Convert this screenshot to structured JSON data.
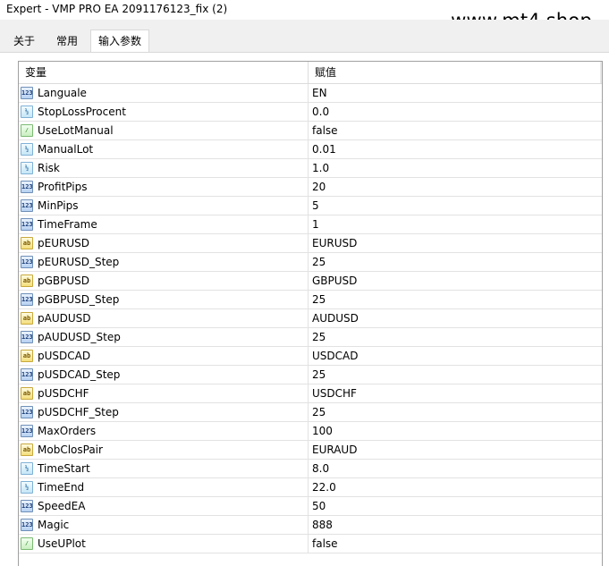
{
  "window": {
    "title": "Expert - VMP PRO EA 2091176123_fix (2)",
    "watermark": "www.mt4.shop"
  },
  "tabs": [
    {
      "label": "关于",
      "active": false
    },
    {
      "label": "常用",
      "active": false
    },
    {
      "label": "输入参数",
      "active": true
    }
  ],
  "grid": {
    "col_variable": "变量",
    "col_value": "赋值",
    "rows": [
      {
        "icon": "int-icon",
        "icon_text": "123",
        "name": "Languale",
        "value": "EN"
      },
      {
        "icon": "double-icon",
        "icon_text": "½",
        "name": "StopLossProcent",
        "value": "0.0"
      },
      {
        "icon": "bool-icon",
        "icon_text": "⁄",
        "name": "UseLotManual",
        "value": "false"
      },
      {
        "icon": "double-icon",
        "icon_text": "½",
        "name": "ManualLot",
        "value": "0.01"
      },
      {
        "icon": "double-icon",
        "icon_text": "½",
        "name": "Risk",
        "value": "1.0"
      },
      {
        "icon": "int-icon",
        "icon_text": "123",
        "name": "ProfitPips",
        "value": "20"
      },
      {
        "icon": "int-icon",
        "icon_text": "123",
        "name": "MinPips",
        "value": "5"
      },
      {
        "icon": "int-icon",
        "icon_text": "123",
        "name": "TimeFrame",
        "value": "1"
      },
      {
        "icon": "string-icon",
        "icon_text": "ab",
        "name": "pEURUSD",
        "value": "EURUSD"
      },
      {
        "icon": "int-icon",
        "icon_text": "123",
        "name": "pEURUSD_Step",
        "value": "25"
      },
      {
        "icon": "string-icon",
        "icon_text": "ab",
        "name": "pGBPUSD",
        "value": "GBPUSD"
      },
      {
        "icon": "int-icon",
        "icon_text": "123",
        "name": "pGBPUSD_Step",
        "value": "25"
      },
      {
        "icon": "string-icon",
        "icon_text": "ab",
        "name": "pAUDUSD",
        "value": "AUDUSD"
      },
      {
        "icon": "int-icon",
        "icon_text": "123",
        "name": "pAUDUSD_Step",
        "value": "25"
      },
      {
        "icon": "string-icon",
        "icon_text": "ab",
        "name": "pUSDCAD",
        "value": "USDCAD"
      },
      {
        "icon": "int-icon",
        "icon_text": "123",
        "name": "pUSDCAD_Step",
        "value": "25"
      },
      {
        "icon": "string-icon",
        "icon_text": "ab",
        "name": "pUSDCHF",
        "value": "USDCHF"
      },
      {
        "icon": "int-icon",
        "icon_text": "123",
        "name": "pUSDCHF_Step",
        "value": "25"
      },
      {
        "icon": "int-icon",
        "icon_text": "123",
        "name": "MaxOrders",
        "value": "100"
      },
      {
        "icon": "string-icon",
        "icon_text": "ab",
        "name": "MobClosPair",
        "value": "EURAUD"
      },
      {
        "icon": "double-icon",
        "icon_text": "½",
        "name": "TimeStart",
        "value": "8.0"
      },
      {
        "icon": "double-icon",
        "icon_text": "½",
        "name": "TimeEnd",
        "value": "22.0"
      },
      {
        "icon": "int-icon",
        "icon_text": "123",
        "name": "SpeedEA",
        "value": "50"
      },
      {
        "icon": "int-icon",
        "icon_text": "123",
        "name": "Magic",
        "value": "888"
      },
      {
        "icon": "bool-icon",
        "icon_text": "⁄",
        "name": "UseUPlot",
        "value": "false"
      }
    ]
  }
}
